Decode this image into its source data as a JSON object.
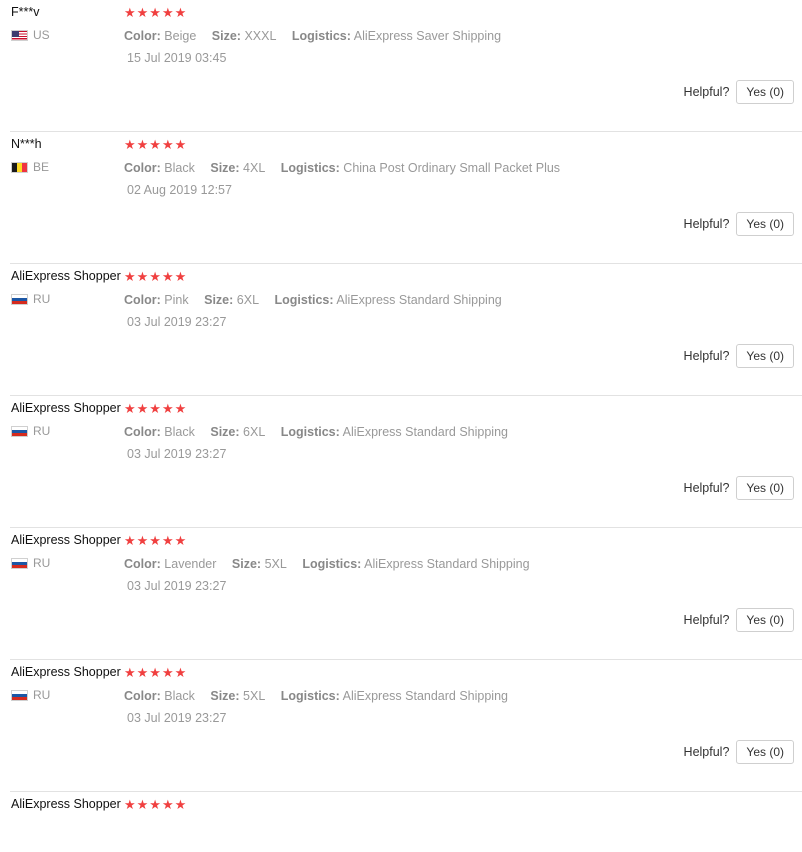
{
  "labels": {
    "color": "Color:",
    "size": "Size:",
    "logistics": "Logistics:",
    "helpful": "Helpful?"
  },
  "reviews": [
    {
      "name": "F***v",
      "flag": "us",
      "country": "US",
      "stars": "★★★★★",
      "color": "Beige",
      "size": "XXXL",
      "logistics": "AliExpress Saver Shipping",
      "date": "15 Jul 2019 03:45",
      "yes": "Yes (0)"
    },
    {
      "name": "N***h",
      "flag": "be",
      "country": "BE",
      "stars": "★★★★★",
      "color": "Black",
      "size": "4XL",
      "logistics": "China Post Ordinary Small Packet Plus",
      "date": "02 Aug 2019 12:57",
      "yes": "Yes (0)"
    },
    {
      "name": "AliExpress Shopper",
      "flag": "ru",
      "country": "RU",
      "stars": "★★★★★",
      "color": "Pink",
      "size": "6XL",
      "logistics": "AliExpress Standard Shipping",
      "date": "03 Jul 2019 23:27",
      "yes": "Yes (0)"
    },
    {
      "name": "AliExpress Shopper",
      "flag": "ru",
      "country": "RU",
      "stars": "★★★★★",
      "color": "Black",
      "size": "6XL",
      "logistics": "AliExpress Standard Shipping",
      "date": "03 Jul 2019 23:27",
      "yes": "Yes (0)"
    },
    {
      "name": "AliExpress Shopper",
      "flag": "ru",
      "country": "RU",
      "stars": "★★★★★",
      "color": "Lavender",
      "size": "5XL",
      "logistics": "AliExpress Standard Shipping",
      "date": "03 Jul 2019 23:27",
      "yes": "Yes (0)"
    },
    {
      "name": "AliExpress Shopper",
      "flag": "ru",
      "country": "RU",
      "stars": "★★★★★",
      "color": "Black",
      "size": "5XL",
      "logistics": "AliExpress Standard Shipping",
      "date": "03 Jul 2019 23:27",
      "yes": "Yes (0)"
    },
    {
      "name": "AliExpress Shopper",
      "flag": "ru",
      "country": "RU",
      "stars": "★★★★★",
      "color": "",
      "size": "",
      "logistics": "",
      "date": "",
      "yes": ""
    }
  ]
}
